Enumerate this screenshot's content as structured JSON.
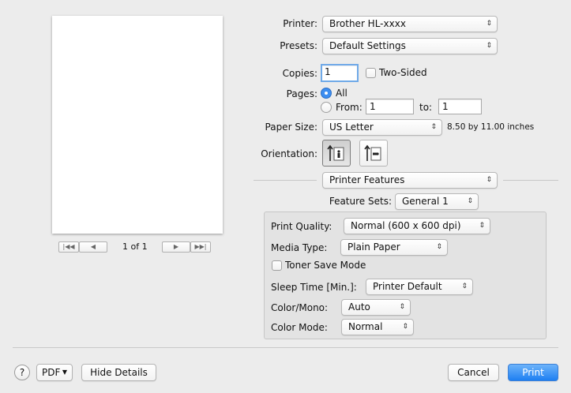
{
  "printer": {
    "label": "Printer:",
    "value": "Brother HL-xxxx"
  },
  "presets": {
    "label": "Presets:",
    "value": "Default Settings"
  },
  "copies": {
    "label": "Copies:",
    "value": "1",
    "two_sided_label": "Two-Sided"
  },
  "pages": {
    "label": "Pages:",
    "all_label": "All",
    "from_label": "From:",
    "from_value": "1",
    "to_label": "to:",
    "to_value": "1"
  },
  "paper_size": {
    "label": "Paper Size:",
    "value": "US Letter",
    "dimensions": "8.50 by 11.00 inches"
  },
  "orientation": {
    "label": "Orientation:"
  },
  "section": {
    "value": "Printer Features"
  },
  "feature_sets": {
    "label": "Feature Sets:",
    "value": "General 1"
  },
  "features": {
    "print_quality": {
      "label": "Print Quality:",
      "value": "Normal (600 x 600 dpi)"
    },
    "media_type": {
      "label": "Media Type:",
      "value": "Plain Paper"
    },
    "toner_save": {
      "label": "Toner Save Mode"
    },
    "sleep_time": {
      "label": "Sleep Time [Min.]:",
      "value": "Printer Default"
    },
    "color_mono": {
      "label": "Color/Mono:",
      "value": "Auto"
    },
    "color_mode": {
      "label": "Color Mode:",
      "value": "Normal"
    }
  },
  "preview": {
    "page_indicator": "1 of 1"
  },
  "footer": {
    "help": "?",
    "pdf": "PDF",
    "hide_details": "Hide Details",
    "cancel": "Cancel",
    "print": "Print"
  },
  "colors": {
    "accent": "#1e7ff2",
    "background": "#ececec"
  },
  "icons": [
    "help-icon",
    "pdf-menu-arrow-icon",
    "portrait-orientation-icon",
    "landscape-orientation-icon",
    "first-page-icon",
    "prev-page-icon",
    "next-page-icon",
    "last-page-icon",
    "popup-arrows-icon"
  ]
}
